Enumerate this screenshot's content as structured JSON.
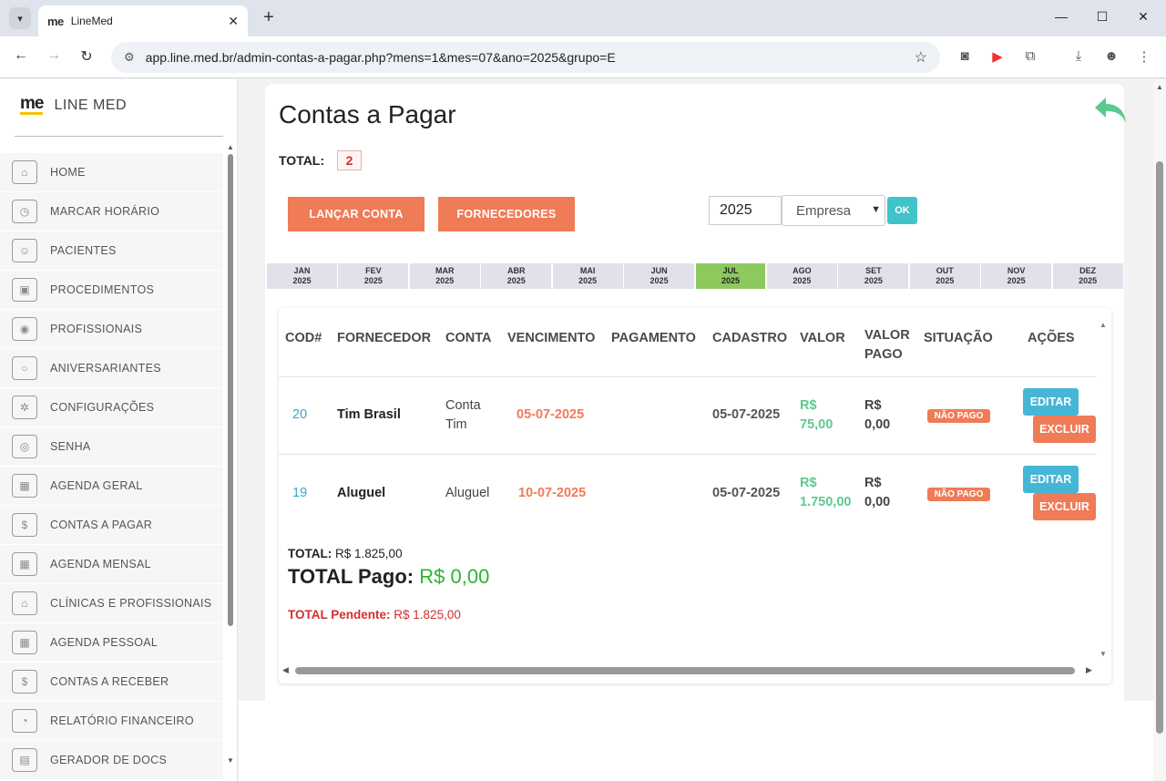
{
  "browser": {
    "tab_title": "LineMed",
    "tab_favicon": "me",
    "url": "app.line.med.br/admin-contas-a-pagar.php?mens=1&mes=07&ano=2025&grupo=E"
  },
  "sidebar": {
    "logo": "me",
    "brand": "LINE MED",
    "items": [
      {
        "label": "HOME",
        "icon": "bank-icon"
      },
      {
        "label": "MARCAR HORÁRIO",
        "icon": "alarm-clock-icon"
      },
      {
        "label": "PACIENTES",
        "icon": "user-icon"
      },
      {
        "label": "PROCEDIMENTOS",
        "icon": "box-icon"
      },
      {
        "label": "PROFISSIONAIS",
        "icon": "user-circle-icon"
      },
      {
        "label": "ANIVERSARIANTES",
        "icon": "balloon-icon"
      },
      {
        "label": "CONFIGURAÇÕES",
        "icon": "gear-icon"
      },
      {
        "label": "SENHA",
        "icon": "fingerprint-icon"
      },
      {
        "label": "AGENDA GERAL",
        "icon": "calendar-icon"
      },
      {
        "label": "CONTAS A PAGAR",
        "icon": "money-icon"
      },
      {
        "label": "AGENDA MENSAL",
        "icon": "calendar-icon"
      },
      {
        "label": "CLÍNICAS E PROFISSIONAIS",
        "icon": "bank-icon"
      },
      {
        "label": "AGENDA PESSOAL",
        "icon": "calendar-icon"
      },
      {
        "label": "CONTAS A RECEBER",
        "icon": "money-icon"
      },
      {
        "label": "RELATÓRIO FINANCEIRO",
        "icon": "pie-chart-icon"
      },
      {
        "label": "GERADOR DE DOCS",
        "icon": "id-card-icon"
      }
    ]
  },
  "page": {
    "title": "Contas a Pagar",
    "total_label": "TOTAL:",
    "total_count": "2",
    "btn_lancar": "LANÇAR CONTA",
    "btn_fornecedores": "FORNECEDORES",
    "year_value": "2025",
    "group_value": "Empresa",
    "ok_label": "OK"
  },
  "months": [
    {
      "m": "JAN",
      "y": "2025"
    },
    {
      "m": "FEV",
      "y": "2025"
    },
    {
      "m": "MAR",
      "y": "2025"
    },
    {
      "m": "ABR",
      "y": "2025"
    },
    {
      "m": "MAI",
      "y": "2025"
    },
    {
      "m": "JUN",
      "y": "2025"
    },
    {
      "m": "JUL",
      "y": "2025"
    },
    {
      "m": "AGO",
      "y": "2025"
    },
    {
      "m": "SET",
      "y": "2025"
    },
    {
      "m": "OUT",
      "y": "2025"
    },
    {
      "m": "NOV",
      "y": "2025"
    },
    {
      "m": "DEZ",
      "y": "2025"
    }
  ],
  "active_month": "JUL",
  "table": {
    "headers": {
      "cod": "COD#",
      "fornecedor": "FORNECEDOR",
      "conta": "CONTA",
      "vencimento": "VENCIMENTO",
      "pagamento": "PAGAMENTO",
      "cadastro": "CADASTRO",
      "valor": "VALOR",
      "valor_pago_1": "VALOR",
      "valor_pago_2": "PAGO",
      "situacao": "SITUAÇÃO",
      "acoes": "AÇÕES"
    },
    "rows": [
      {
        "cod": "20",
        "fornecedor": "Tim Brasil",
        "conta_1": "Conta",
        "conta_2": "Tim",
        "vencimento": "05-07-2025",
        "pagamento": "",
        "cadastro": "05-07-2025",
        "valor_1": "R$",
        "valor_2": "75,00",
        "pago_1": "R$",
        "pago_2": "0,00",
        "situacao": "NÃO PAGO",
        "edit": "EDITAR",
        "del": "EXCLUIR"
      },
      {
        "cod": "19",
        "fornecedor": "Aluguel",
        "conta_1": "Aluguel",
        "conta_2": "",
        "vencimento": "10-07-2025",
        "pagamento": "",
        "cadastro": "05-07-2025",
        "valor_1": "R$",
        "valor_2": "1.750,00",
        "pago_1": "R$",
        "pago_2": "0,00",
        "situacao": "NÃO PAGO",
        "edit": "EDITAR",
        "del": "EXCLUIR"
      }
    ]
  },
  "summary": {
    "total_label": "TOTAL:",
    "total_value": "R$ 1.825,00",
    "pago_label": "TOTAL Pago:",
    "pago_value": "R$ 0,00",
    "pendente_label": "TOTAL Pendente:",
    "pendente_value": "R$ 1.825,00"
  },
  "colors": {
    "accent_orange": "#ef7b57",
    "accent_teal": "#40c4c9",
    "active_month": "#8ec95e",
    "paid_green": "#2db52d",
    "pending_red": "#d32f2f"
  }
}
